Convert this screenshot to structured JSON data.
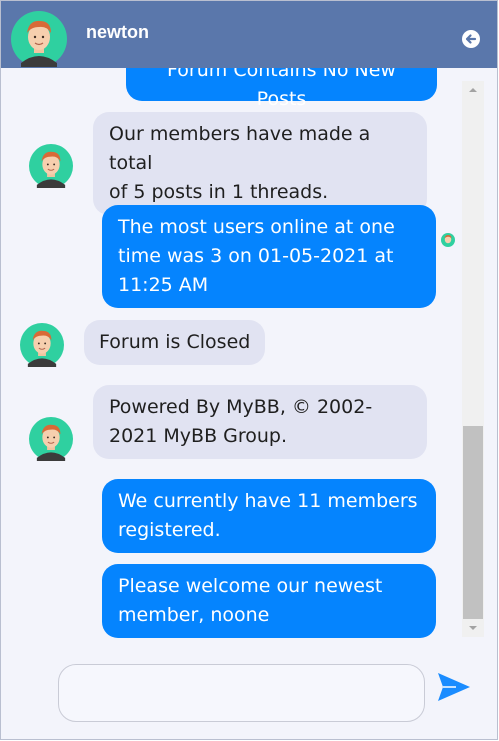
{
  "header": {
    "name": "newton",
    "avatar_icon": "user-avatar-icon",
    "back_icon": "back-arrow-icon"
  },
  "messages": [
    {
      "side": "out",
      "text": "Forum Contains No New Posts"
    },
    {
      "side": "in",
      "lines": [
        "Our members have made a total",
        "of 5 posts in 1 threads."
      ]
    },
    {
      "side": "out",
      "lines": [
        "The most users online at one",
        "time was 3 on 01-05-2021 at",
        "11:25 AM"
      ]
    },
    {
      "side": "in",
      "text": "Forum is Closed"
    },
    {
      "side": "in",
      "lines": [
        "Powered By MyBB, © 2002-",
        "2021 MyBB Group."
      ]
    },
    {
      "side": "out",
      "lines": [
        "We currently have 11 members",
        "registered."
      ]
    },
    {
      "side": "out",
      "lines": [
        "Please welcome our newest",
        "member, noone"
      ]
    }
  ],
  "composer": {
    "value": "",
    "placeholder": "",
    "send_icon": "send-icon"
  },
  "colors": {
    "header": "#5a77ab",
    "outgoing_bubble": "#0584fe",
    "incoming_bubble": "#e1e3f2",
    "background": "#f3f4fb",
    "send_icon": "#1a8cff"
  }
}
